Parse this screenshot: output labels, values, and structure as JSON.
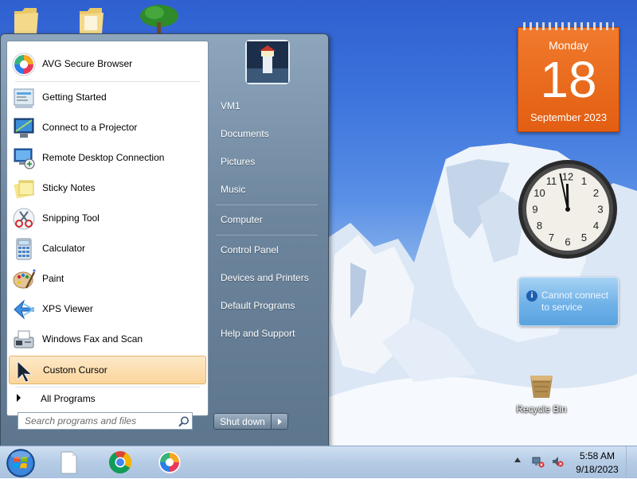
{
  "desktop": {
    "icons": [
      {
        "name": "folder-icon"
      },
      {
        "name": "folder-icon"
      },
      {
        "name": "tree-icon"
      }
    ],
    "recycle_bin_label": "Recycle Bin"
  },
  "gadgets": {
    "calendar": {
      "day_name": "Monday",
      "date": "18",
      "month_year": "September 2023",
      "color": "#e86a1c"
    },
    "clock": {
      "numerals": [
        "12",
        "1",
        "2",
        "3",
        "4",
        "5",
        "6",
        "7",
        "8",
        "9",
        "10",
        "11"
      ],
      "hour": 11,
      "minute": 58
    },
    "notice": {
      "icon": "info-icon",
      "text": "Cannot connect to service"
    }
  },
  "start_menu": {
    "pinned": [
      {
        "label": "AVG Secure Browser",
        "icon": "avg-browser-icon"
      }
    ],
    "recent": [
      {
        "label": "Getting Started",
        "icon": "getting-started-icon"
      },
      {
        "label": "Connect to a Projector",
        "icon": "projector-icon"
      },
      {
        "label": "Remote Desktop Connection",
        "icon": "remote-desktop-icon"
      },
      {
        "label": "Sticky Notes",
        "icon": "sticky-notes-icon"
      },
      {
        "label": "Snipping Tool",
        "icon": "snipping-tool-icon"
      },
      {
        "label": "Calculator",
        "icon": "calculator-icon"
      },
      {
        "label": "Paint",
        "icon": "paint-icon"
      },
      {
        "label": "XPS Viewer",
        "icon": "xps-viewer-icon"
      },
      {
        "label": "Windows Fax and Scan",
        "icon": "fax-scan-icon"
      },
      {
        "label": "Custom Cursor",
        "icon": "custom-cursor-icon"
      }
    ],
    "all_programs": "All Programs",
    "search_placeholder": "Search programs and files",
    "right": [
      {
        "label": "VM1"
      },
      {
        "label": "Documents"
      },
      {
        "label": "Pictures"
      },
      {
        "label": "Music"
      },
      {
        "label": "Computer"
      },
      {
        "label": "Control Panel"
      },
      {
        "label": "Devices and Printers"
      },
      {
        "label": "Default Programs"
      },
      {
        "label": "Help and Support"
      }
    ],
    "shutdown_label": "Shut down"
  },
  "taskbar": {
    "pinned": [
      {
        "name": "notepad-icon"
      },
      {
        "name": "chrome-icon"
      },
      {
        "name": "avg-browser-icon"
      }
    ],
    "tray": {
      "time": "5:58 AM",
      "date": "9/18/2023",
      "icons": [
        "network-icon",
        "volume-muted-icon"
      ]
    }
  },
  "colors": {
    "accent_highlight": "#fcd59c",
    "taskbar": "#b7cde6",
    "start_menu_right": "#6c859d"
  }
}
